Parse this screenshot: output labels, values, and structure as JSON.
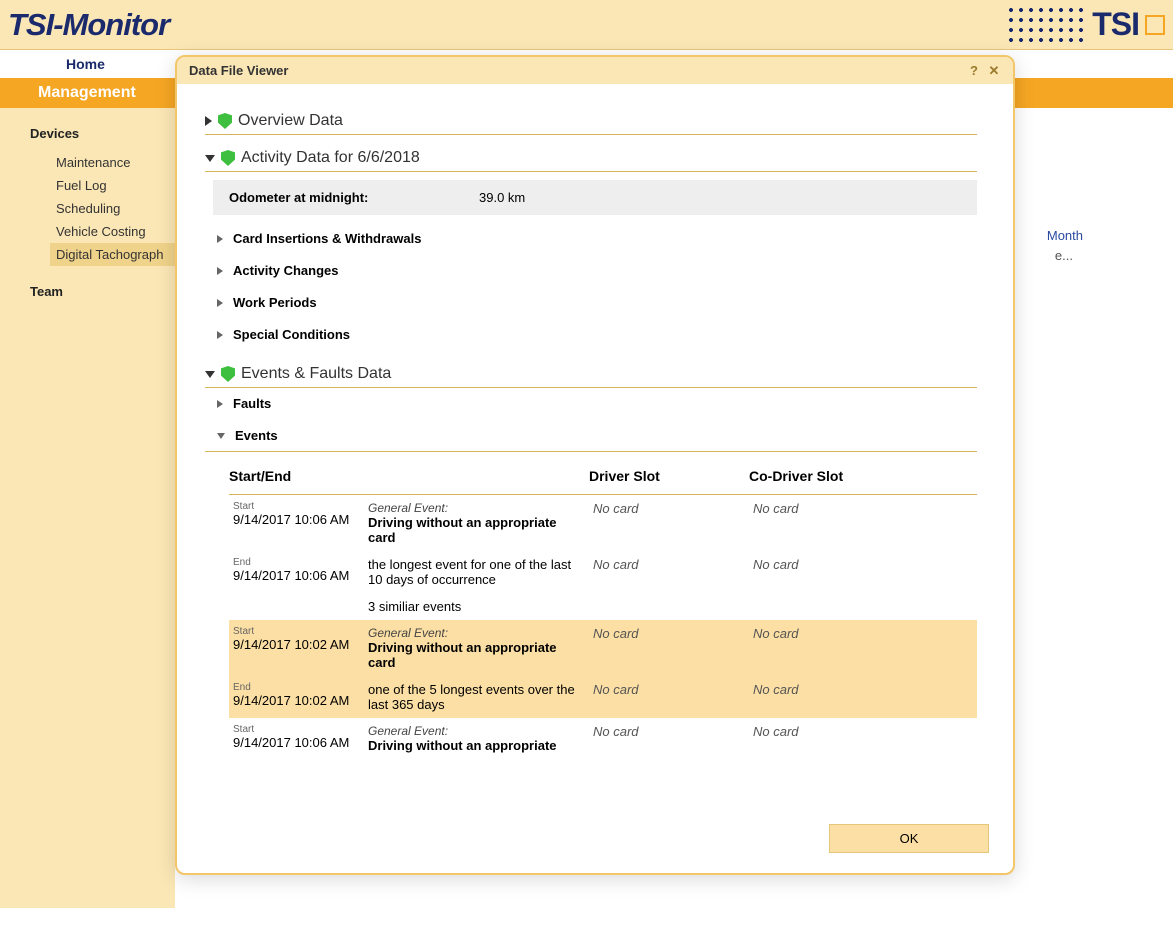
{
  "app_title": "TSI-Monitor",
  "logo_text": "TSI",
  "tabs": {
    "home": "Home"
  },
  "subheader": "Management",
  "sidebar": {
    "devices": "Devices",
    "subitems": {
      "maintenance": "Maintenance",
      "fuel_log": "Fuel Log",
      "scheduling": "Scheduling",
      "vehicle_costing": "Vehicle Costing",
      "digital_tacho": "Digital Tachograph"
    },
    "team": "Team"
  },
  "background": {
    "month_link": "Month",
    "extra": "e..."
  },
  "modal": {
    "title": "Data File Viewer",
    "sections": {
      "overview": "Overview Data",
      "activity": "Activity Data for 6/6/2018",
      "events_faults": "Events & Faults Data"
    },
    "odometer": {
      "label": "Odometer at midnight:",
      "value": "39.0 km"
    },
    "subsections": {
      "card_insertions": "Card Insertions & Withdrawals",
      "activity_changes": "Activity Changes",
      "work_periods": "Work Periods",
      "special_conditions": "Special Conditions",
      "faults": "Faults",
      "events": "Events"
    },
    "events_table": {
      "headers": {
        "start_end": "Start/End",
        "driver_slot": "Driver Slot",
        "codriver_slot": "Co-Driver Slot"
      },
      "labels": {
        "start": "Start",
        "end": "End",
        "general_event": "General Event:",
        "no_card": "No card"
      },
      "rows": [
        {
          "start_time": "9/14/2017 10:06 AM",
          "start_title": "Driving without an appropriate card",
          "end_time": "9/14/2017 10:06 AM",
          "end_note": "the longest event for one of the last 10 days of occurrence",
          "extra_note": "3 similiar events",
          "highlighted": false
        },
        {
          "start_time": "9/14/2017 10:02 AM",
          "start_title": "Driving without an appropriate card",
          "end_time": "9/14/2017 10:02 AM",
          "end_note": "one of the 5 longest events over the last 365 days",
          "extra_note": "",
          "highlighted": true
        },
        {
          "start_time": "9/14/2017 10:06 AM",
          "start_title": "Driving without an appropriate",
          "end_time": "",
          "end_note": "",
          "extra_note": "",
          "highlighted": false
        }
      ]
    },
    "ok_button": "OK"
  }
}
